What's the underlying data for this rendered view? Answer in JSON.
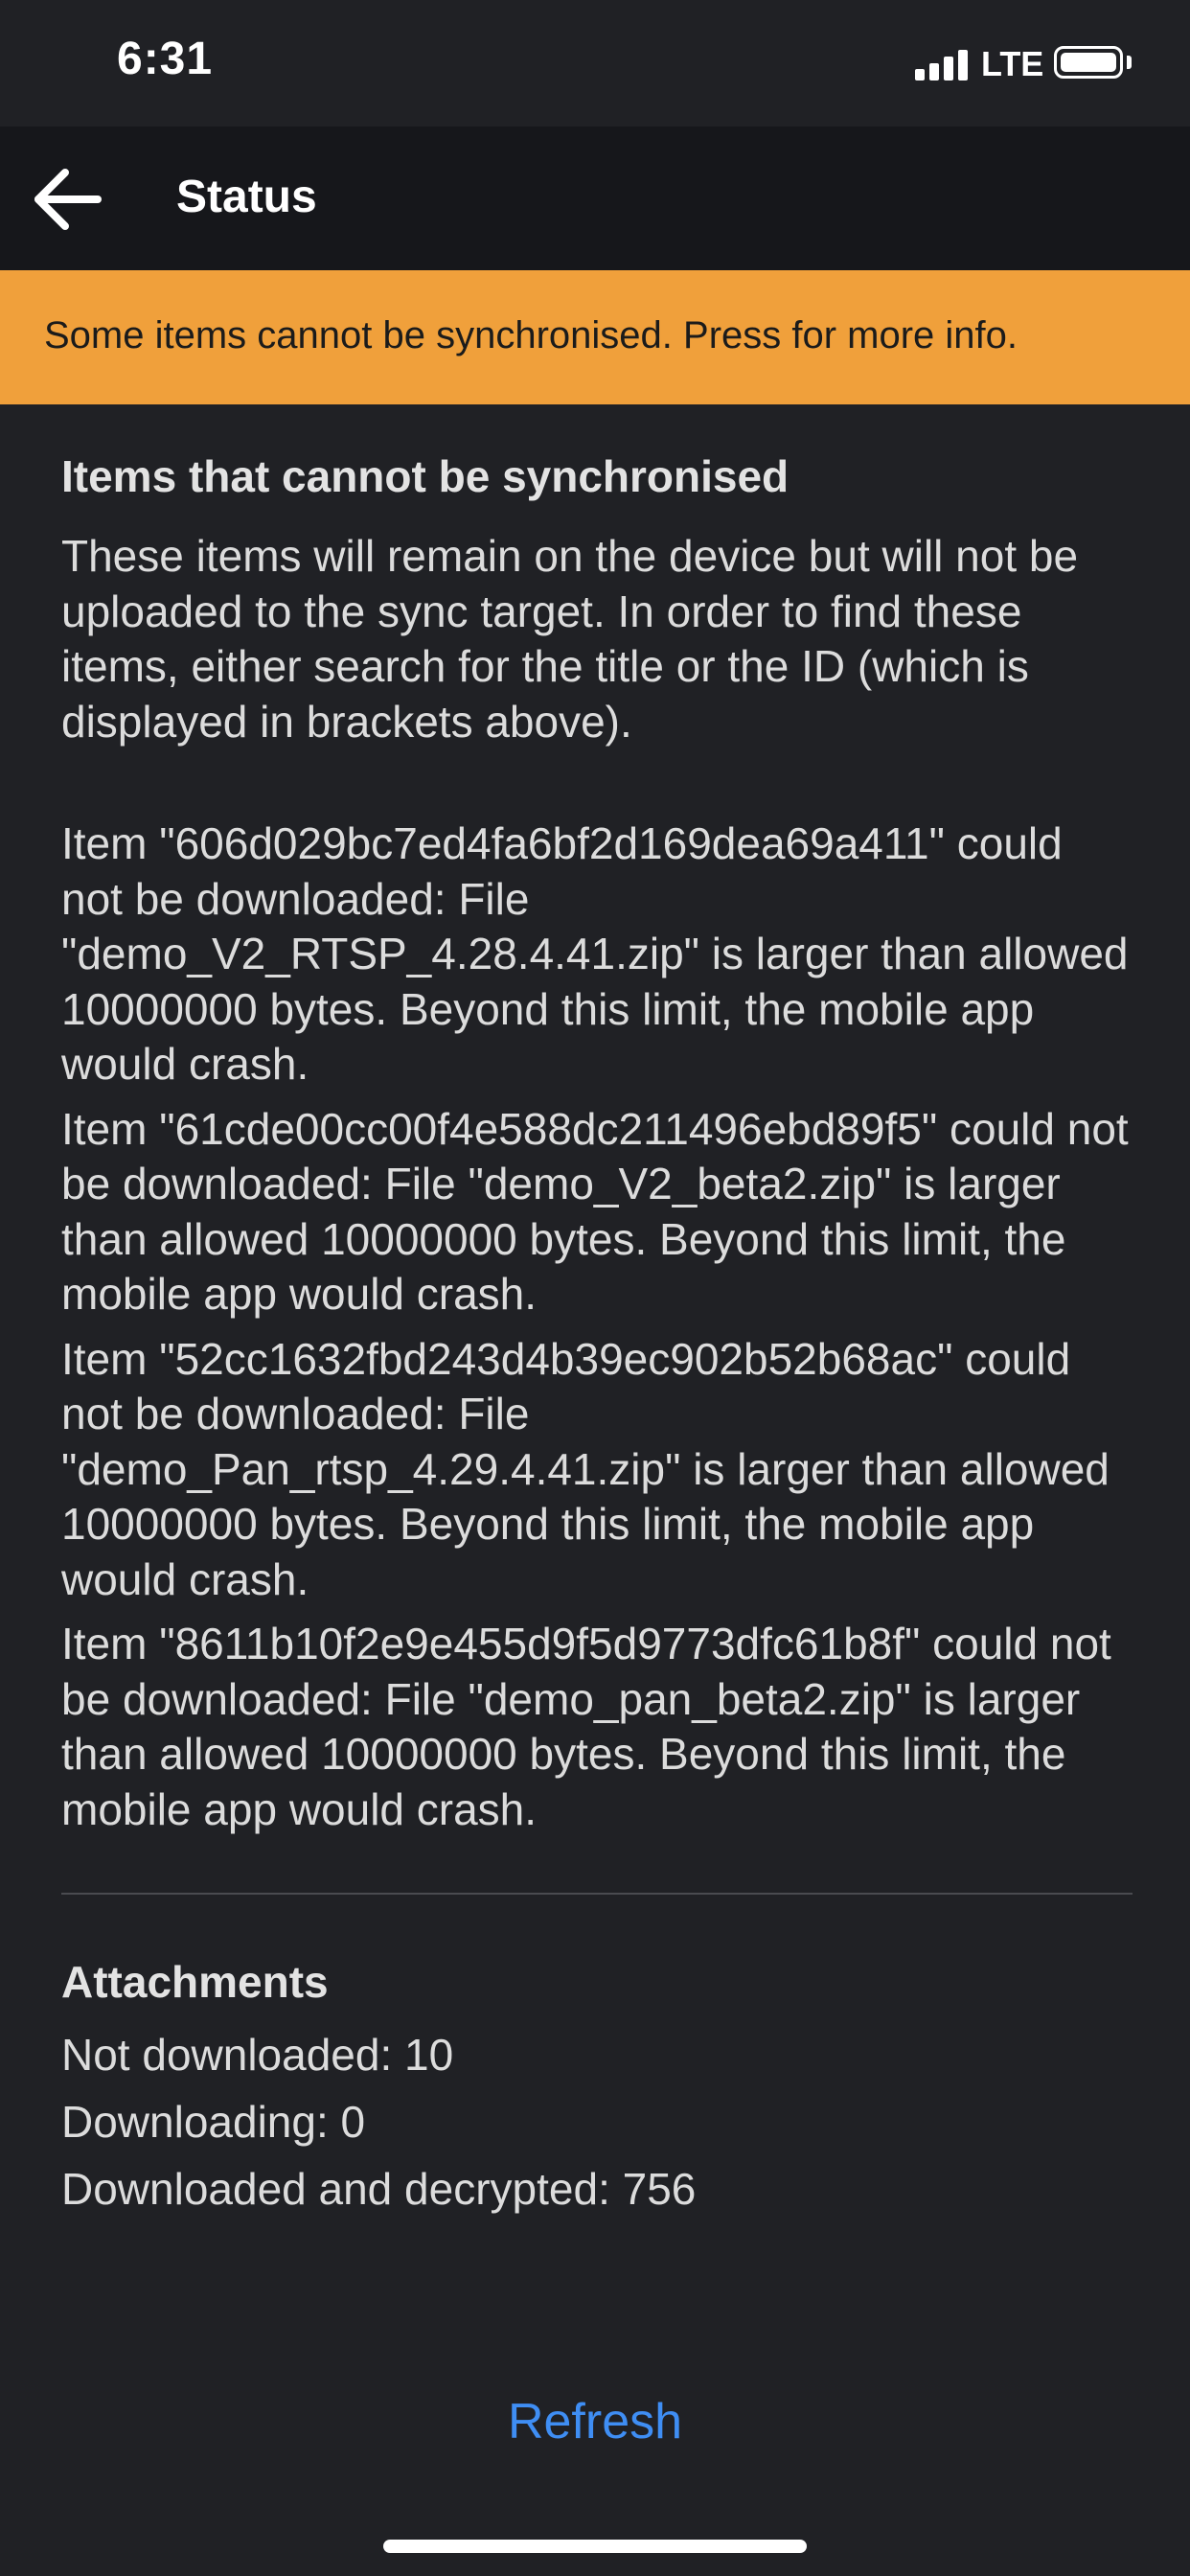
{
  "status_bar": {
    "time": "6:31",
    "network": "LTE",
    "battery_level": 1.0,
    "signal_bars": 4
  },
  "header": {
    "title": "Status",
    "back_icon": "arrow-left-icon"
  },
  "banner": {
    "text": "Some items cannot be synchronised. Press for more info.",
    "color": "#f0a03b"
  },
  "sync_section": {
    "heading": "Items that cannot be synchronised",
    "description": "These items will remain on the device but will not be uploaded to the sync target. In order to find these items, either search for the title or the ID (which is displayed in brackets above).",
    "items": [
      "Item \"606d029bc7ed4fa6bf2d169dea69a411\" could not be downloaded: File \"demo_V2_RTSP_4.28.4.41.zip\" is larger than allowed 10000000 bytes. Beyond this limit, the mobile app would crash.",
      "Item \"61cde00cc00f4e588dc211496ebd89f5\" could not be downloaded: File \"demo_V2_beta2.zip\" is larger than allowed 10000000 bytes. Beyond this limit, the mobile app would crash.",
      "Item \"52cc1632fbd243d4b39ec902b52b68ac\" could not be downloaded: File \"demo_Pan_rtsp_4.29.4.41.zip\" is larger than allowed 10000000 bytes. Beyond this limit, the mobile app would crash.",
      "Item \"8611b10f2e9e455d9f5d9773dfc61b8f\" could not be downloaded: File \"demo_pan_beta2.zip\" is larger than allowed 10000000 bytes. Beyond this limit, the mobile app would crash."
    ]
  },
  "attachments": {
    "heading": "Attachments",
    "not_downloaded": "Not downloaded: 10",
    "downloading": "Downloading: 0",
    "downloaded": "Downloaded and decrypted: 756"
  },
  "actions": {
    "refresh_label": "Refresh",
    "accent_color": "#3f8ef4"
  }
}
